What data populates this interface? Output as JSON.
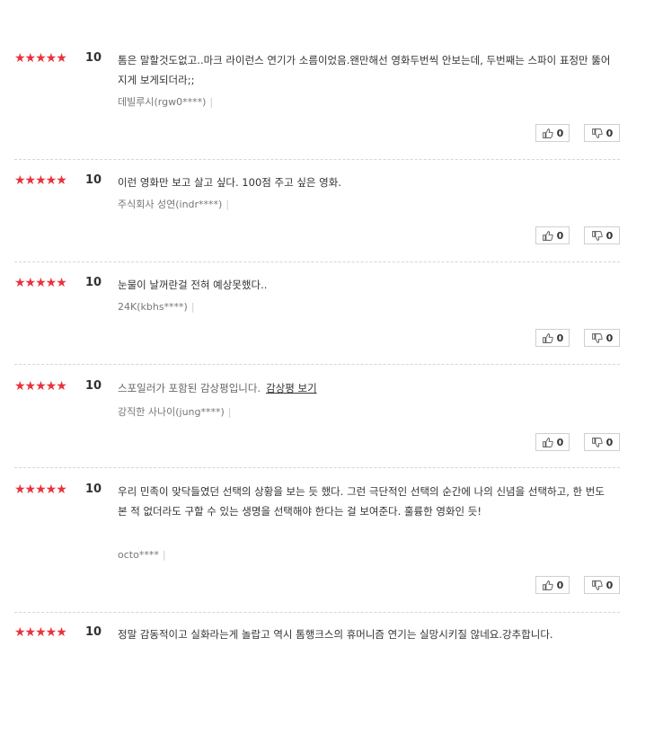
{
  "ratings": {
    "thumb_up_icon": "thumb-up-icon",
    "thumb_down_icon": "thumb-down-icon"
  },
  "reviews": [
    {
      "stars": "★★★★★",
      "score": "10",
      "text": "톰은 말할것도없고..마크 라이런스 연기가 소름이었음.왠만해선 영화두번씩 안보는데, 두번째는 스파이 표정만 뚫어지게 보게되더라;;",
      "author": "데빌루시(rgw0****)",
      "likes": "0",
      "dislikes": "0"
    },
    {
      "stars": "★★★★★",
      "score": "10",
      "text": "이런 영화만 보고 살고 싶다. 100점 주고 싶은 영화.",
      "author": "주식회사 성연(indr****)",
      "likes": "0",
      "dislikes": "0"
    },
    {
      "stars": "★★★★★",
      "score": "10",
      "text": "눈물이 날꺼란걸 전혀 예상못했다..",
      "author": "24K(kbhs****)",
      "likes": "0",
      "dislikes": "0"
    },
    {
      "stars": "★★★★★",
      "score": "10",
      "spoiler_text": "스포일러가 포함된 감상평입니다.",
      "spoiler_link": "감상평 보기",
      "author": "강직한 사나이(jung****)",
      "likes": "0",
      "dislikes": "0"
    },
    {
      "stars": "★★★★★",
      "score": "10",
      "text": "우리 민족이 맞닥들였던 선택의 상황을 보는 듯 했다. 그런 극단적인 선택의 순간에 나의 신념을 선택하고, 한 번도 본 적 없더라도 구할 수 있는 생명을 선택해야 한다는 걸 보여준다. 훌륭한 영화인 듯!",
      "author": "octo****",
      "likes": "0",
      "dislikes": "0"
    },
    {
      "stars": "★★★★★",
      "score": "10",
      "text": "정말 감동적이고 실화라는게 놀랍고 역시 톰행크스의 휴머니즘 연기는 실망시키질 않네요.강추합니다."
    }
  ]
}
